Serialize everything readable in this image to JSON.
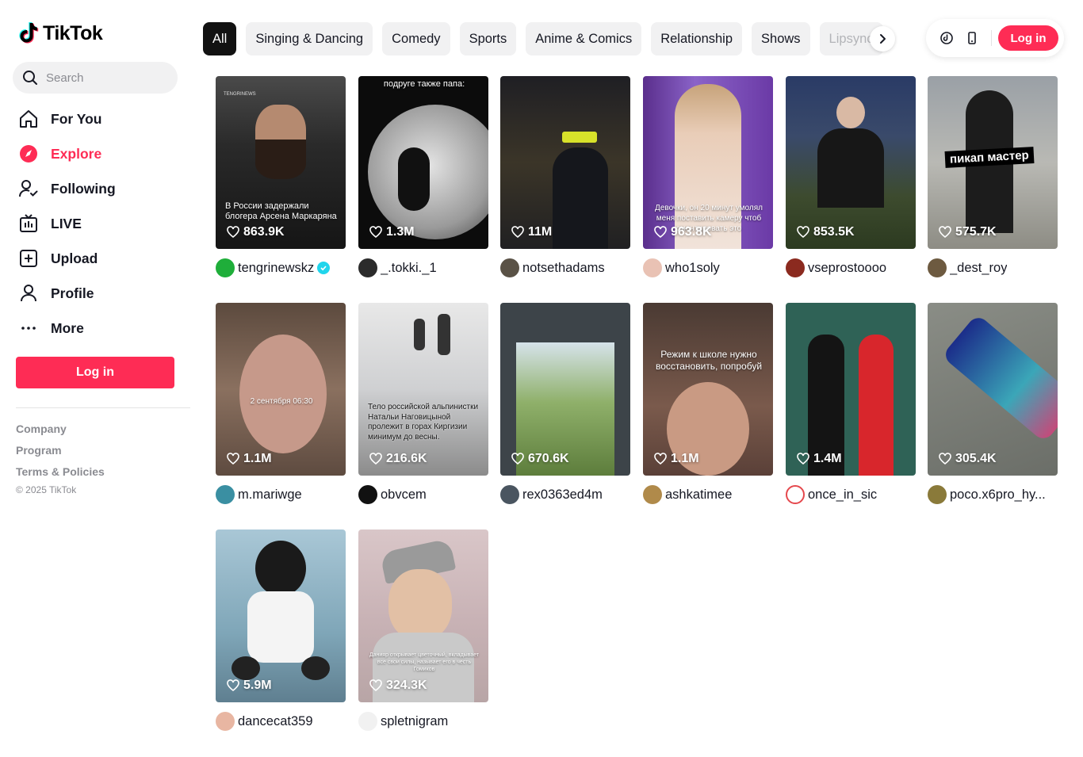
{
  "brand": {
    "name": "TikTok"
  },
  "search": {
    "placeholder": "Search"
  },
  "nav": [
    {
      "label": "For You",
      "icon": "home-icon"
    },
    {
      "label": "Explore",
      "icon": "compass-icon",
      "active": true
    },
    {
      "label": "Following",
      "icon": "following-icon"
    },
    {
      "label": "LIVE",
      "icon": "live-tv-icon"
    },
    {
      "label": "Upload",
      "icon": "upload-icon"
    },
    {
      "label": "Profile",
      "icon": "profile-icon"
    },
    {
      "label": "More",
      "icon": "more-icon"
    }
  ],
  "sidebar": {
    "login_label": "Log in"
  },
  "footer": {
    "links": [
      "Company",
      "Program",
      "Terms & Policies"
    ],
    "copyright": "© 2025 TikTok"
  },
  "categories": [
    "All",
    "Singing & Dancing",
    "Comedy",
    "Sports",
    "Anime & Comics",
    "Relationship",
    "Shows",
    "Lipsync"
  ],
  "header": {
    "login_label": "Log in"
  },
  "colors": {
    "brand_accent": "#fe2c55",
    "verified": "#20d5ec"
  },
  "videos": [
    {
      "likes": "863.9K",
      "author": "tengrinewskz",
      "verified": true,
      "caption": "В России задержали блогера Арсена Маркаряна"
    },
    {
      "likes": "1.3M",
      "author": "_.tokki._1",
      "caption": "подруге также папа:"
    },
    {
      "likes": "11M",
      "author": "notsethadams"
    },
    {
      "likes": "963.8K",
      "author": "who1soly",
      "caption": "Девочки, он 20 минут умолял меня поставить камеру чтоб смонтировать это"
    },
    {
      "likes": "853.5K",
      "author": "vseprostoooo"
    },
    {
      "likes": "575.7K",
      "author": "_dest_roy",
      "caption": "пикап мастер"
    },
    {
      "likes": "1.1M",
      "author": "m.mariwge",
      "caption": "2 сентября 06:30"
    },
    {
      "likes": "216.6K",
      "author": "obvcem",
      "caption": "Тело российской альпинистки Натальи Наговицыной пролежит в горах Киргизии минимум до весны."
    },
    {
      "likes": "670.6K",
      "author": "rex0363ed4m"
    },
    {
      "likes": "1.1M",
      "author": "ashkatimee",
      "caption": "Режим к школе нужно восстановить, попробуй"
    },
    {
      "likes": "1.4M",
      "author": "once_in_sic"
    },
    {
      "likes": "305.4K",
      "author": "poco.x6pro_hy..."
    },
    {
      "likes": "5.9M",
      "author": "dancecat359"
    },
    {
      "likes": "324.3K",
      "author": "spletnigram",
      "caption": "Данияр открывает цветочный, вкладывает все свои силы, называет его в честь Гомиков"
    }
  ]
}
